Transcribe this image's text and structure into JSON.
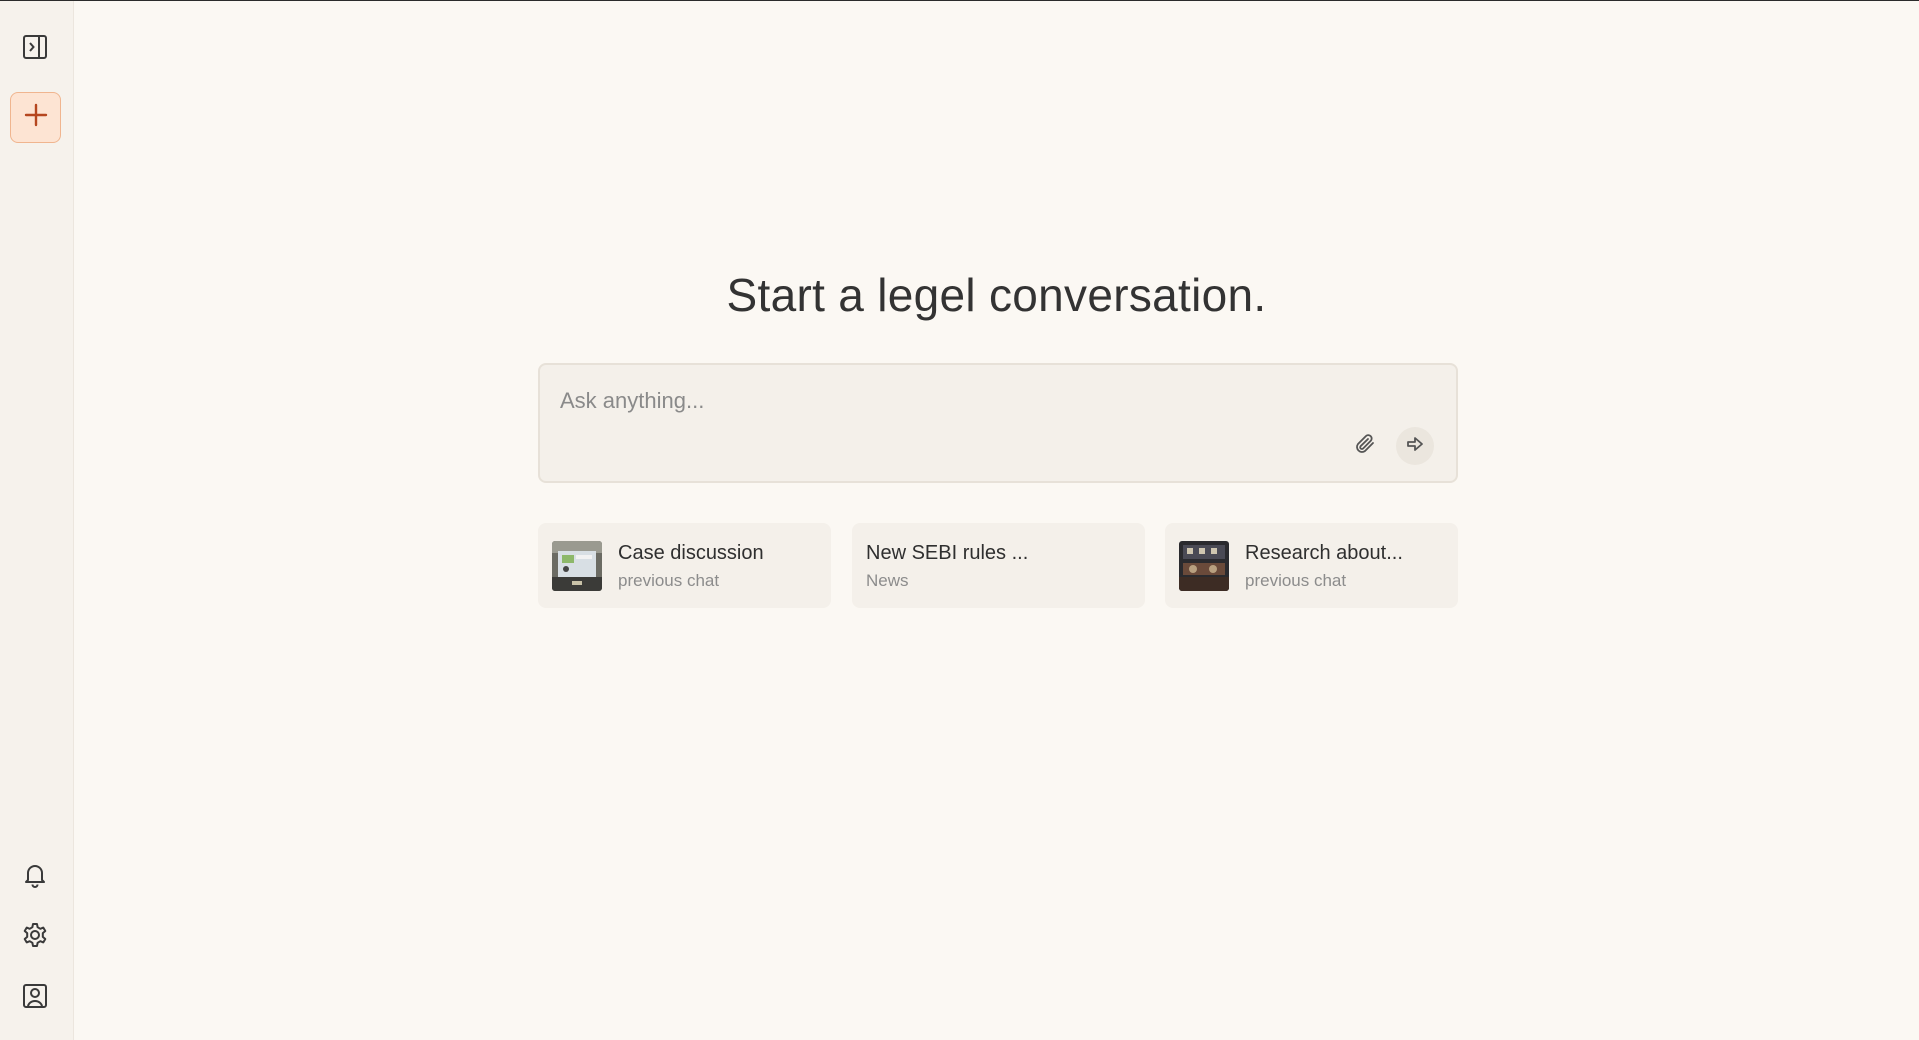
{
  "sidebar": {
    "toggle_icon": "sidebar-toggle-icon",
    "new_chat_icon": "plus-icon",
    "bottom_icons": [
      "bell-icon",
      "gear-icon",
      "profile-icon"
    ],
    "accent_color": "#fde4d3",
    "accent_border": "#f0b58f",
    "plus_color": "#b5461f"
  },
  "main": {
    "title": "Start a legel conversation.",
    "ask": {
      "placeholder": "Ask anything...",
      "value": "",
      "attach_icon": "paperclip-icon",
      "send_icon": "arrow-right-icon"
    },
    "cards": [
      {
        "title": "Case discussion",
        "subtitle": "previous chat",
        "has_thumb": true
      },
      {
        "title": "New SEBI rules ...",
        "subtitle": "News",
        "has_thumb": false
      },
      {
        "title": "Research about...",
        "subtitle": "previous chat",
        "has_thumb": true
      }
    ]
  }
}
